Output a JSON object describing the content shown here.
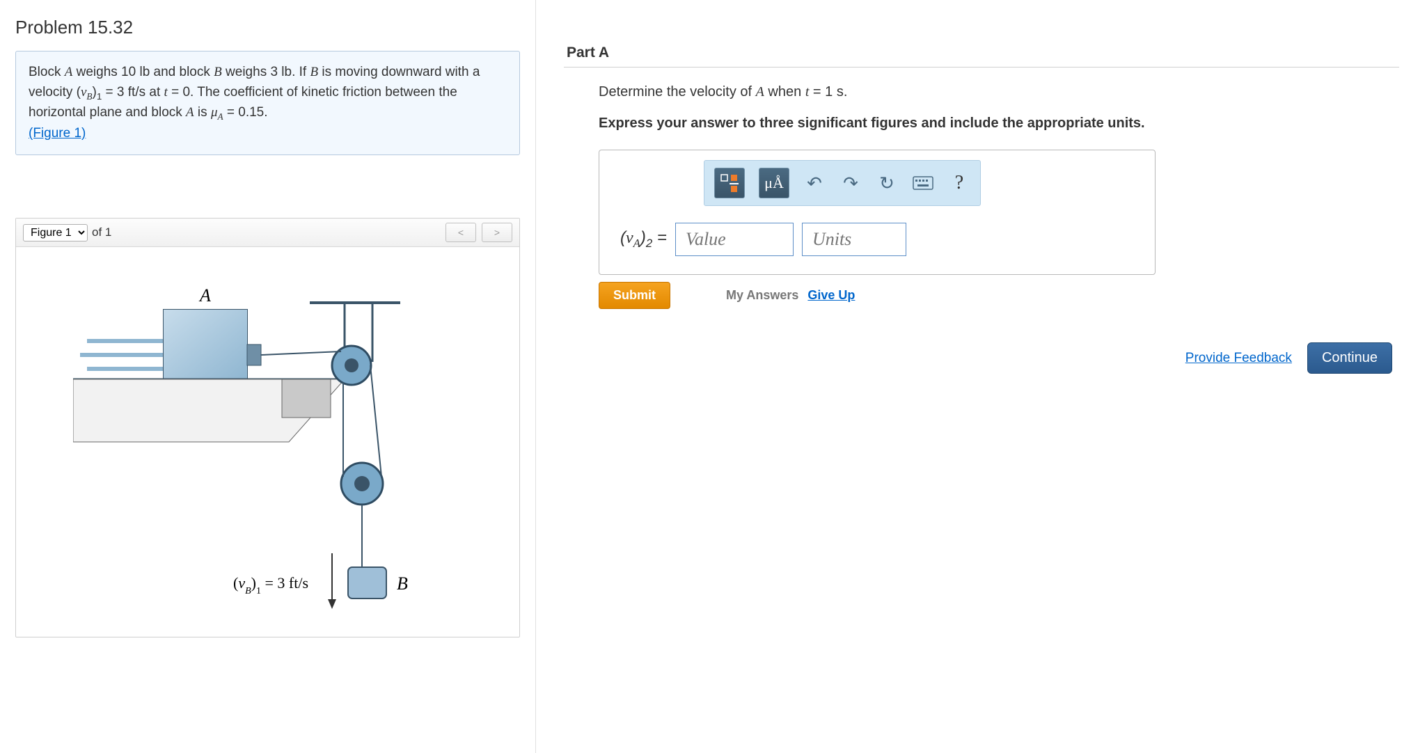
{
  "problem": {
    "title": "Problem 15.32",
    "text_html": "Block <span class='serif-i'>A</span> weighs 10 lb and block <span class='serif-i'>B</span> weighs 3 lb. If <span class='serif-i'>B</span> is moving downward with a velocity (<span class='serif-i'>v<sub>B</sub></span>)<sub>1</sub> = 3 ft/s at <span class='serif-i'>t</span> = 0. The coefficient of kinetic friction between the horizontal plane and block <span class='serif-i'>A</span> is <span class='serif-i'>μ<sub>A</sub></span> = 0.15.",
    "figure_link": "(Figure 1)"
  },
  "figure": {
    "selector_label": "Figure 1",
    "of_label": "of 1",
    "labels": {
      "A": "A",
      "B": "B",
      "vB": "(v_B)_1 = 3 ft/s"
    }
  },
  "part": {
    "heading": "Part A",
    "question_html": "Determine the velocity of <span class='serif-i'>A</span> when <span class='serif-i'>t</span> = 1 s.",
    "instruction": "Express your answer to three significant figures and include the appropriate units."
  },
  "toolbar": {
    "template_btn": "template",
    "units_btn": "μÅ",
    "undo": "↶",
    "redo": "↷",
    "reset": "↻",
    "keyboard": "⌨",
    "help": "?"
  },
  "answer": {
    "var_html": "(<span class='serif-i'>v<sub>A</sub></span>)<sub>2</sub> =",
    "value_placeholder": "Value",
    "units_placeholder": "Units"
  },
  "actions": {
    "submit": "Submit",
    "my_answers": "My Answers",
    "give_up": "Give Up",
    "feedback": "Provide Feedback",
    "continue": "Continue"
  }
}
